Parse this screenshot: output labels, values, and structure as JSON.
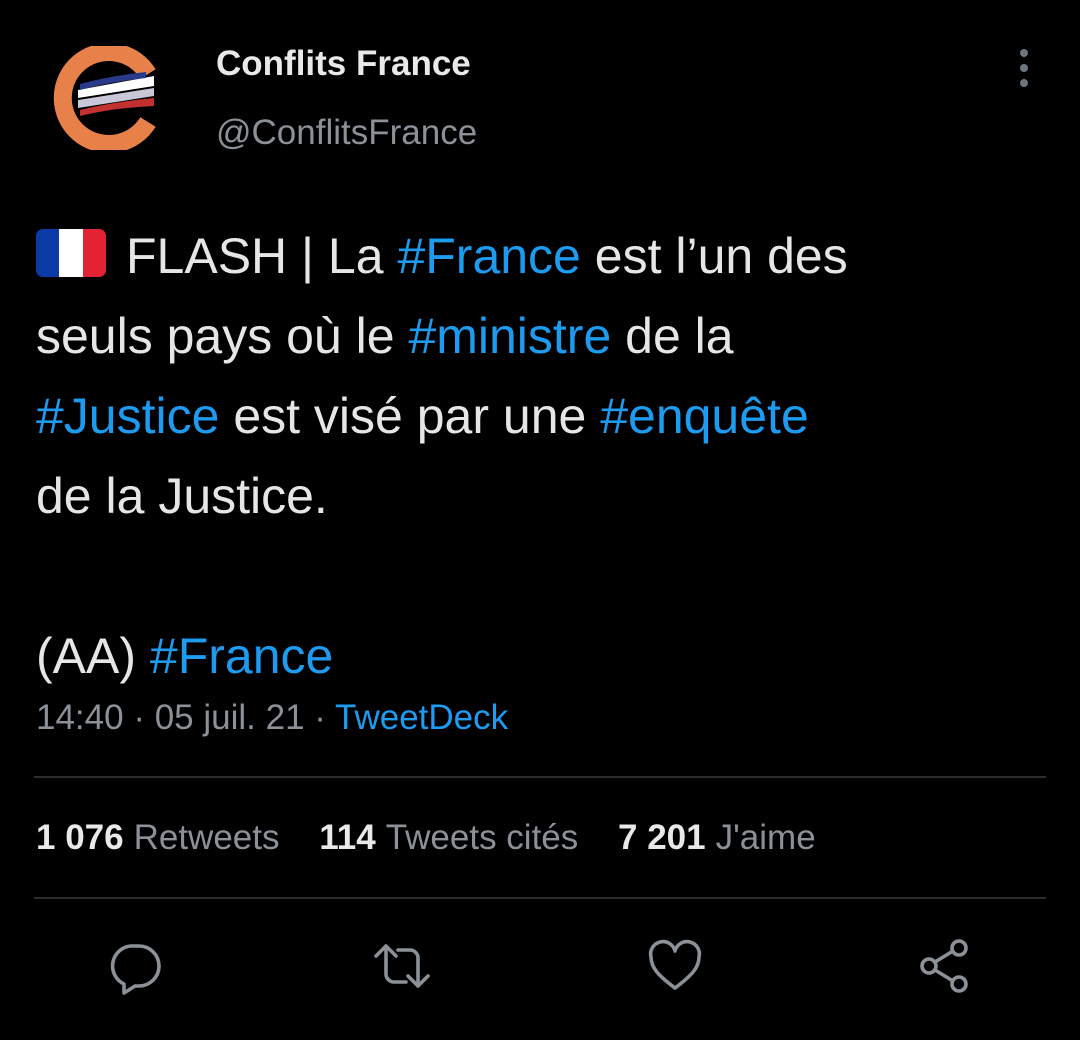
{
  "author": {
    "display_name": "Conflits France",
    "handle": "@ConflitsFrance",
    "avatar_icon": "conflits-france-logo-icon"
  },
  "tweet": {
    "flag_icon": "france-flag-icon",
    "line1_pre": "FLASH | La ",
    "line1_tag": "#France",
    "line1_post": " est l’un des",
    "line2_pre": "seuls pays où le ",
    "line2_tag": "#ministre",
    "line2_post": " de la",
    "line3_tag1": "#Justice",
    "line3_mid": " est visé par une ",
    "line3_tag2": "#enquête",
    "line4": "de la Justice.",
    "line6_pre": "(AA) ",
    "line6_tag": "#France"
  },
  "meta": {
    "time": "14:40",
    "separator": " · ",
    "date": "05 juil. 21",
    "source": "TweetDeck"
  },
  "stats": {
    "retweets_count": "1 076",
    "retweets_label": "Retweets",
    "quotes_count": "114",
    "quotes_label": "Tweets cités",
    "likes_count": "7 201",
    "likes_label": "J'aime"
  },
  "actions": [
    "reply-icon",
    "retweet-icon",
    "like-icon",
    "share-icon"
  ],
  "colors": {
    "background": "#000000",
    "hashtag": "#1d9bf0",
    "secondary_text": "#8b9196",
    "logo_orange": "#e8804a",
    "flag_blue": "#0a3aa8",
    "flag_red": "#e32334"
  }
}
